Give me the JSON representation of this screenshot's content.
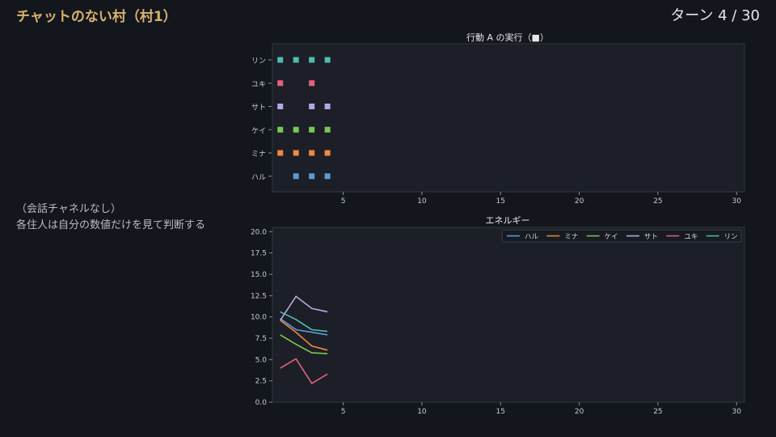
{
  "header": {
    "title": "チャットのない村（村1）",
    "turn": "ターン 4 / 30"
  },
  "note": {
    "line1": "（会話チャネルなし）",
    "line2": "各住人は自分の数値だけを見て判断する"
  },
  "colors": {
    "ハル": "#5b9bd5",
    "ミナ": "#f0883e",
    "ケイ": "#7bc950",
    "サト": "#b4a7e5",
    "ユキ": "#e8617a",
    "リン": "#4dbfb0"
  },
  "chart_data": [
    {
      "type": "scatter",
      "title": "行動 A の実行（■）",
      "x": [
        1,
        2,
        3,
        4
      ],
      "xlim": [
        0.5,
        30.5
      ],
      "xticks": [
        5,
        10,
        15,
        20,
        25,
        30
      ],
      "categories": [
        "ハル",
        "ミナ",
        "ケイ",
        "サト",
        "ユキ",
        "リン"
      ],
      "series": [
        {
          "name": "リン",
          "x": [
            1,
            2,
            3,
            4
          ]
        },
        {
          "name": "ユキ",
          "x": [
            1,
            3
          ]
        },
        {
          "name": "サト",
          "x": [
            1,
            3,
            4
          ]
        },
        {
          "name": "ケイ",
          "x": [
            1,
            2,
            3,
            4
          ]
        },
        {
          "name": "ミナ",
          "x": [
            1,
            2,
            3,
            4
          ]
        },
        {
          "name": "ハル",
          "x": [
            2,
            3,
            4
          ]
        }
      ],
      "grid": false
    },
    {
      "type": "line",
      "title": "エネルギー",
      "x": [
        1,
        2,
        3,
        4
      ],
      "xlim": [
        0.5,
        30.5
      ],
      "ylim": [
        0,
        20.5
      ],
      "xticks": [
        5,
        10,
        15,
        20,
        25,
        30
      ],
      "yticks": [
        "0.0",
        "2.5",
        "5.0",
        "7.5",
        "10.0",
        "12.5",
        "15.0",
        "17.5",
        "20.0"
      ],
      "legend": "top-right",
      "series": [
        {
          "name": "ハル",
          "values": [
            9.8,
            8.5,
            8.2,
            7.9
          ]
        },
        {
          "name": "ミナ",
          "values": [
            9.6,
            8.2,
            6.6,
            6.1
          ]
        },
        {
          "name": "ケイ",
          "values": [
            7.9,
            6.8,
            5.8,
            5.7
          ]
        },
        {
          "name": "サト",
          "values": [
            9.6,
            12.4,
            11.0,
            10.6
          ]
        },
        {
          "name": "ユキ",
          "values": [
            4.0,
            5.1,
            2.2,
            3.3
          ]
        },
        {
          "name": "リン",
          "values": [
            10.6,
            9.7,
            8.5,
            8.3
          ]
        }
      ],
      "grid": false
    }
  ]
}
